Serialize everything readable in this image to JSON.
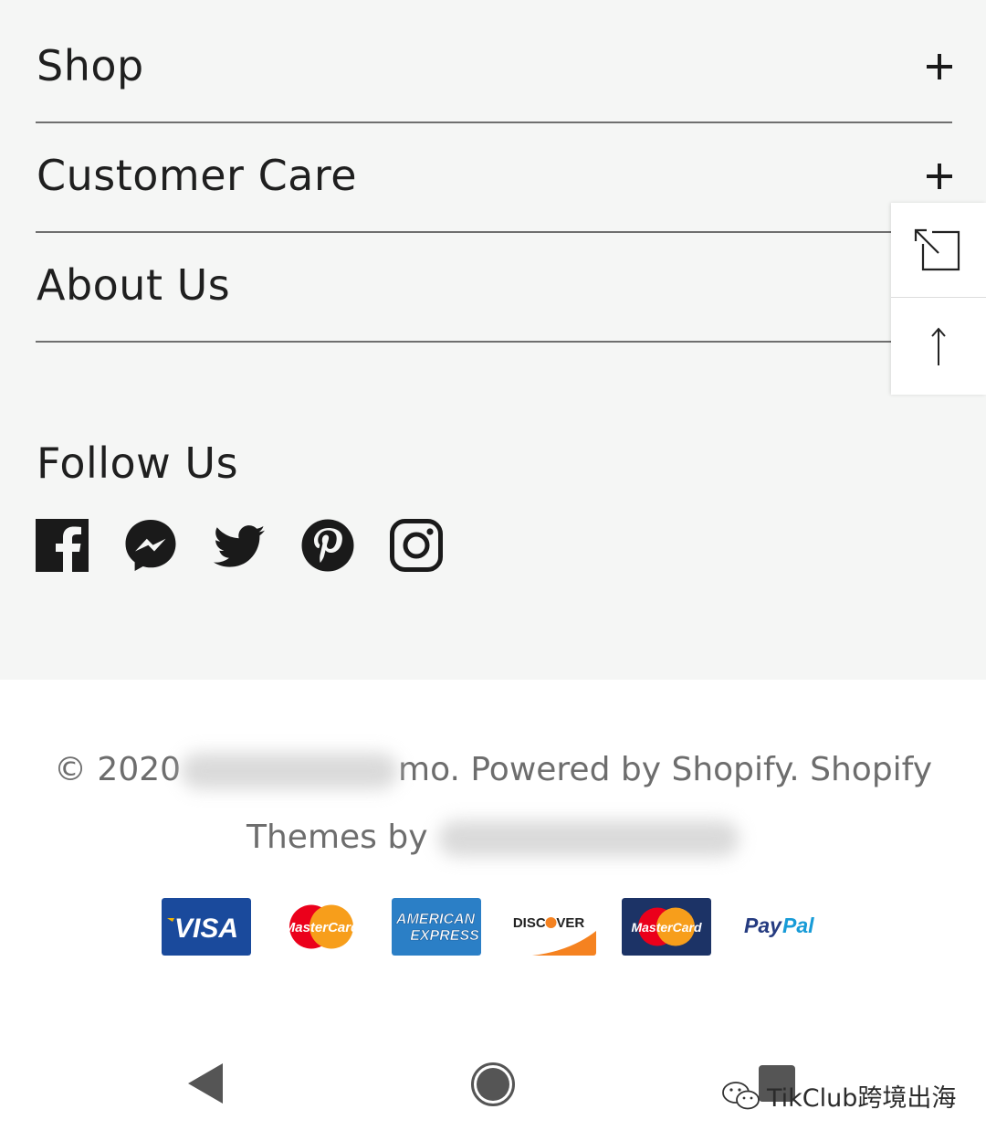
{
  "footer_menu": {
    "items": [
      {
        "label": "Shop",
        "icon": "plus-icon"
      },
      {
        "label": "Customer Care",
        "icon": "plus-icon"
      },
      {
        "label": "About Us",
        "icon": "plus-icon"
      }
    ]
  },
  "social": {
    "title": "Follow Us",
    "icons": [
      "facebook-icon",
      "messenger-icon",
      "twitter-icon",
      "pinterest-icon",
      "instagram-icon"
    ]
  },
  "floating_tools": {
    "icons": [
      "expand-icon",
      "back-to-top-icon"
    ]
  },
  "copyright": {
    "prefix": "© 2020",
    "middle": "mo. Powered by Shopify. Shopify",
    "line2": "Themes by"
  },
  "payments": {
    "visa": "VISA",
    "mastercard": "MasterCard",
    "amex_line1": "AMERICAN",
    "amex_line2": "EXPRESS",
    "discover": "DISCOVER",
    "mastercard_dark": "MasterCard",
    "paypal_pay": "Pay",
    "paypal_pal": "Pal"
  },
  "nav_bar": {
    "icons": [
      "back-icon",
      "home-icon",
      "recents-icon"
    ]
  },
  "watermark": {
    "text": "TikClub跨境出海",
    "icon": "wechat-icon"
  },
  "colors": {
    "background_top": "#f5f6f5",
    "text": "#1f1f1f",
    "muted_text": "#6d6d6d",
    "visa_blue": "#1a4a9c",
    "amex_blue": "#2b7fc6",
    "discover_orange": "#f58220",
    "mastercard_red": "#eb001b",
    "mastercard_yellow": "#f79e1b",
    "paypal_dark": "#253b80",
    "paypal_light": "#179bd7"
  }
}
